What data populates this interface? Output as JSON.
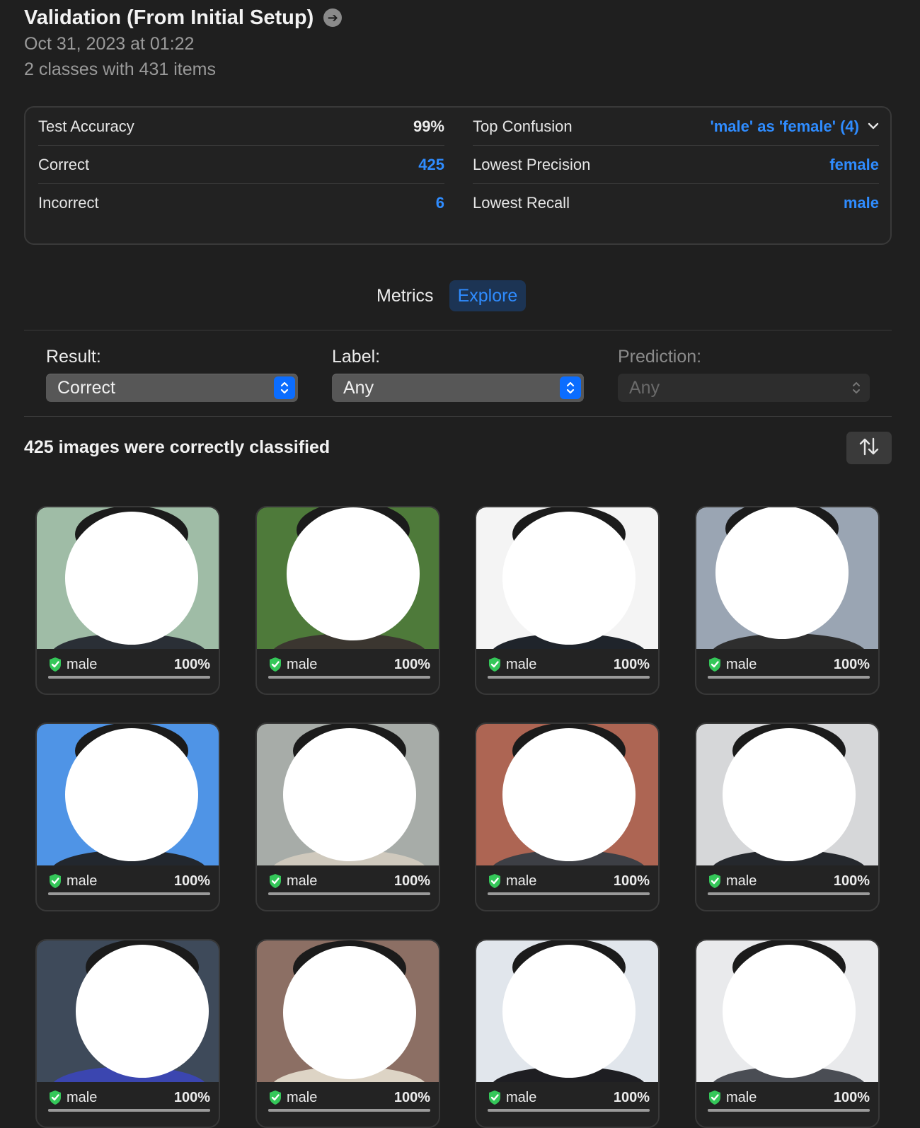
{
  "header": {
    "title": "Validation (From Initial Setup)",
    "date": "Oct 31, 2023 at 01:22",
    "summary": "2 classes with 431 items"
  },
  "metrics_left": [
    {
      "label": "Test Accuracy",
      "value": "99%"
    },
    {
      "label": "Correct",
      "value": "425"
    },
    {
      "label": "Incorrect",
      "value": "6"
    }
  ],
  "metrics_right": [
    {
      "label": "Top Confusion",
      "value": "'male' as 'female' (4)"
    },
    {
      "label": "Lowest Precision",
      "value": "female"
    },
    {
      "label": "Lowest Recall",
      "value": "male"
    }
  ],
  "tabs": {
    "metrics": "Metrics",
    "explore": "Explore",
    "active": "explore"
  },
  "filters": {
    "result": {
      "label": "Result:",
      "value": "Correct"
    },
    "label": {
      "label": "Label:",
      "value": "Any"
    },
    "prediction": {
      "label": "Prediction:",
      "value": "Any",
      "disabled": true
    }
  },
  "results_title": "425 images were correctly classified",
  "colors": {
    "accent": "#2f8cff",
    "check": "#34c759"
  },
  "cards": [
    {
      "label": "male",
      "confidence": "100%",
      "bg": "#9fbca6",
      "shirt": "#2a2f36"
    },
    {
      "label": "male",
      "confidence": "100%",
      "bg": "#4e7a3a",
      "shirt": "#3b3630"
    },
    {
      "label": "male",
      "confidence": "100%",
      "bg": "#f4f4f4",
      "shirt": "#1f242b"
    },
    {
      "label": "male",
      "confidence": "100%",
      "bg": "#9aa5b3",
      "shirt": "#2e2e2e"
    },
    {
      "label": "male",
      "confidence": "100%",
      "bg": "#4f94e6",
      "shirt": "#22272e"
    },
    {
      "label": "male",
      "confidence": "100%",
      "bg": "#a7aca8",
      "shirt": "#cfc9bd"
    },
    {
      "label": "male",
      "confidence": "100%",
      "bg": "#ad6553",
      "shirt": "#3d3f45"
    },
    {
      "label": "male",
      "confidence": "100%",
      "bg": "#d6d7d9",
      "shirt": "#25282d"
    },
    {
      "label": "male",
      "confidence": "100%",
      "bg": "#3e4a5a",
      "shirt": "#3b46b0"
    },
    {
      "label": "male",
      "confidence": "100%",
      "bg": "#8c6f64",
      "shirt": "#ddd4c5"
    },
    {
      "label": "male",
      "confidence": "100%",
      "bg": "#e1e6ec",
      "shirt": "#1e1e22"
    },
    {
      "label": "male",
      "confidence": "100%",
      "bg": "#e9eaec",
      "shirt": "#4a4d54"
    }
  ]
}
